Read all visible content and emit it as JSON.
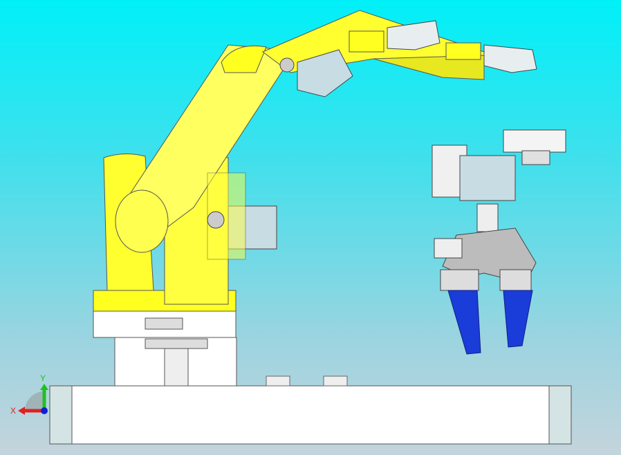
{
  "viewport": {
    "title": "3D model view"
  },
  "triad": {
    "x_label": "X",
    "y_label": "Y",
    "x_color": "#e02020",
    "y_color": "#20c020",
    "z_color": "#1020d0"
  },
  "colors": {
    "arm": "#ffff20",
    "servo": "#c8dce4",
    "finger": "#1a3cd8",
    "plate": "#ffffff"
  }
}
